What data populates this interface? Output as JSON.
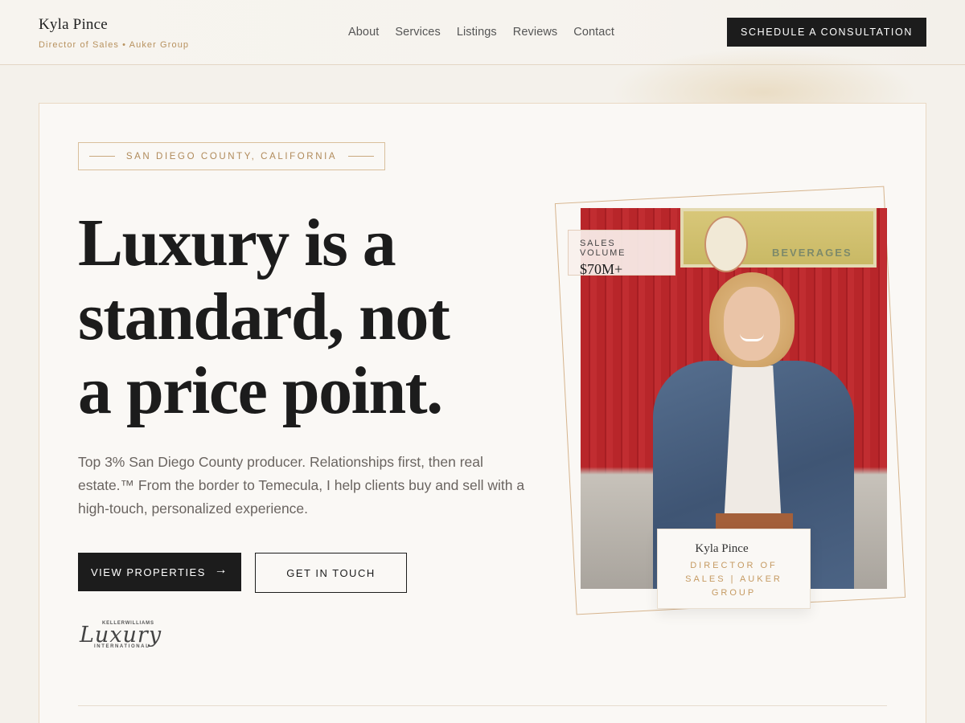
{
  "header": {
    "brand_name": "Kyla Pince",
    "brand_subtitle": "Director of Sales • Auker Group",
    "nav": [
      "About",
      "Services",
      "Listings",
      "Reviews",
      "Contact"
    ],
    "cta_label": "SCHEDULE A CONSULTATION"
  },
  "hero": {
    "location_tag": "SAN DIEGO COUNTY, CALIFORNIA",
    "headline_lines": [
      "Luxury is a",
      "standard, not",
      "a price point."
    ],
    "description": "Top 3% San Diego County producer. Relationships first, then real estate.™ From the border to Temecula, I help clients buy and sell with a high-touch, personalized experience.",
    "primary_button": "VIEW PROPERTIES",
    "secondary_button": "GET IN TOUCH",
    "logo": {
      "top": "KELLERWILLIAMS",
      "script": "Luxury",
      "bottom": "INTERNATIONAL"
    }
  },
  "photo": {
    "sign_text": "BEVERAGES",
    "stat_label": "SALES VOLUME",
    "stat_value": "$70M+",
    "name": "Kyla Pince",
    "role": "DIRECTOR OF SALES | AUKER GROUP"
  },
  "colors": {
    "accent": "#b8925f",
    "dark": "#1c1c1c",
    "background": "#f4f1eb"
  }
}
